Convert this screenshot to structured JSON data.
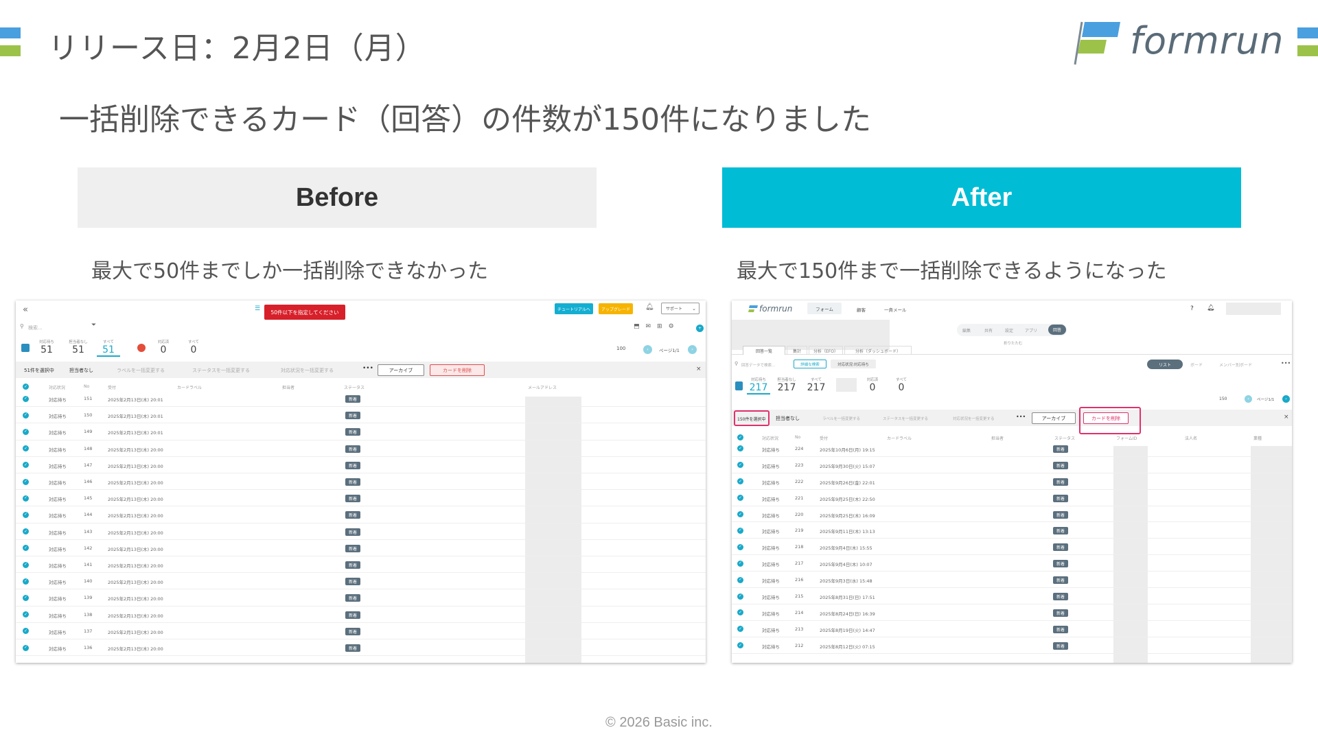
{
  "slide": {
    "title": "リリース日：2月2日（月）",
    "headline": "一括削除できるカード（回答）の件数が150件になりました",
    "logo_text": "formrun",
    "footer": "© 2026 Basic inc.",
    "colors": {
      "accent_cyan": "#00bcd4",
      "banner_gray": "#efefef",
      "deco_blue": "#4a9fdf",
      "deco_green": "#9cc24a",
      "highlight_red": "#e0306b"
    }
  },
  "before": {
    "banner_label": "Before",
    "description": "最大で50件までしか一括削除できなかった",
    "screenshot": {
      "error_toast": "50件以下を指定してください",
      "tutorial_button": "チュートリアルへ",
      "upgrade_button": "アップグレード",
      "support_select": "サポート",
      "search_placeholder": "検索...",
      "counts": [
        {
          "label": "対応待ち",
          "value": "51"
        },
        {
          "label": "担当者なし",
          "value": "51"
        },
        {
          "label": "すべて",
          "value": "51"
        },
        {
          "label": "対応済",
          "value": "0"
        },
        {
          "label": "すべて",
          "value": "0"
        }
      ],
      "per_page": "100",
      "page_indicator": "ページ1/1",
      "selected_count": "51件を選択中",
      "assignee_none": "担当者なし",
      "label_bulk": "ラベルを一括変更する",
      "status_bulk": "ステータスを一括変更する",
      "handler_bulk": "対応状況を一括変更する",
      "archive_button": "アーカイブ",
      "delete_button": "カードを削除",
      "columns": [
        "対応状況",
        "No",
        "受付",
        "カードラベル",
        "担当者",
        "ステータス",
        "メールアドレス"
      ],
      "rows": [
        {
          "status": "対応待ち",
          "no": "151",
          "date": "2025年2月13日(木) 20:01",
          "badge": "新着"
        },
        {
          "status": "対応待ち",
          "no": "150",
          "date": "2025年2月13日(木) 20:01",
          "badge": "新着"
        },
        {
          "status": "対応待ち",
          "no": "149",
          "date": "2025年2月13日(木) 20:01",
          "badge": "新着"
        },
        {
          "status": "対応待ち",
          "no": "148",
          "date": "2025年2月13日(木) 20:00",
          "badge": "新着"
        },
        {
          "status": "対応待ち",
          "no": "147",
          "date": "2025年2月13日(木) 20:00",
          "badge": "新着"
        },
        {
          "status": "対応待ち",
          "no": "146",
          "date": "2025年2月13日(木) 20:00",
          "badge": "新着"
        },
        {
          "status": "対応待ち",
          "no": "145",
          "date": "2025年2月13日(木) 20:00",
          "badge": "新着"
        },
        {
          "status": "対応待ち",
          "no": "144",
          "date": "2025年2月13日(木) 20:00",
          "badge": "新着"
        },
        {
          "status": "対応待ち",
          "no": "143",
          "date": "2025年2月13日(木) 20:00",
          "badge": "新着"
        },
        {
          "status": "対応待ち",
          "no": "142",
          "date": "2025年2月13日(木) 20:00",
          "badge": "新着"
        },
        {
          "status": "対応待ち",
          "no": "141",
          "date": "2025年2月13日(木) 20:00",
          "badge": "新着"
        },
        {
          "status": "対応待ち",
          "no": "140",
          "date": "2025年2月13日(木) 20:00",
          "badge": "新着"
        },
        {
          "status": "対応待ち",
          "no": "139",
          "date": "2025年2月13日(木) 20:00",
          "badge": "新着"
        },
        {
          "status": "対応待ち",
          "no": "138",
          "date": "2025年2月13日(木) 20:00",
          "badge": "新着"
        },
        {
          "status": "対応待ち",
          "no": "137",
          "date": "2025年2月13日(木) 20:00",
          "badge": "新着"
        },
        {
          "status": "対応待ち",
          "no": "136",
          "date": "2025年2月13日(木) 20:00",
          "badge": "新着"
        }
      ]
    }
  },
  "after": {
    "banner_label": "After",
    "description": "最大で150件まで一括削除できるようになった",
    "screenshot": {
      "logo_text": "formrun",
      "nav_tabs": [
        "フォーム",
        "顧客",
        "一斉メール"
      ],
      "sub_tabs": [
        "編集",
        "共有",
        "設定",
        "アプリ",
        "回答"
      ],
      "collapse_link": "折りたたむ",
      "view_tabs": [
        "回答一覧",
        "集計",
        "分析（EFO）",
        "分析（ダッシュボード）"
      ],
      "search_placeholder": "回答データで検索...",
      "filter_detail": "詳細な検索",
      "filter_chip": "対応状況:対応待ち",
      "view_modes": [
        "リスト",
        "ボード",
        "メンバー別ボード"
      ],
      "counts": [
        {
          "label": "対応待ち",
          "value": "217"
        },
        {
          "label": "担当者なし",
          "value": "217"
        },
        {
          "label": "すべて",
          "value": "217"
        },
        {
          "label": "対応済",
          "value": "0"
        },
        {
          "label": "すべて",
          "value": "0"
        }
      ],
      "per_page": "150",
      "page_indicator": "ページ1/1",
      "selected_count": "150件を選択中",
      "assignee_none": "担当者なし",
      "label_bulk": "ラベルを一括変更する",
      "status_bulk": "ステータスを一括変更する",
      "handler_bulk": "対応状況を一括変更する",
      "archive_button": "アーカイブ",
      "delete_button": "カードを削除",
      "columns": [
        "対応状況",
        "No",
        "受付",
        "カードラベル",
        "担当者",
        "ステータス",
        "フォームID",
        "法人名",
        "業種"
      ],
      "rows": [
        {
          "status": "対応待ち",
          "no": "224",
          "date": "2025年10月6日(月) 19:15",
          "badge": "新着"
        },
        {
          "status": "対応待ち",
          "no": "223",
          "date": "2025年9月30日(火) 15:07",
          "badge": "新着"
        },
        {
          "status": "対応待ち",
          "no": "222",
          "date": "2025年9月26日(金) 22:01",
          "badge": "新着"
        },
        {
          "status": "対応待ち",
          "no": "221",
          "date": "2025年9月25日(木) 22:50",
          "badge": "新着"
        },
        {
          "status": "対応待ち",
          "no": "220",
          "date": "2025年9月25日(木) 16:09",
          "badge": "新着"
        },
        {
          "status": "対応待ち",
          "no": "219",
          "date": "2025年9月11日(木) 13:13",
          "badge": "新着"
        },
        {
          "status": "対応待ち",
          "no": "218",
          "date": "2025年9月4日(木) 15:55",
          "badge": "新着"
        },
        {
          "status": "対応待ち",
          "no": "217",
          "date": "2025年9月4日(木) 10:07",
          "badge": "新着"
        },
        {
          "status": "対応待ち",
          "no": "216",
          "date": "2025年9月3日(水) 15:48",
          "badge": "新着"
        },
        {
          "status": "対応待ち",
          "no": "215",
          "date": "2025年8月31日(日) 17:51",
          "badge": "新着"
        },
        {
          "status": "対応待ち",
          "no": "214",
          "date": "2025年8月24日(日) 16:39",
          "badge": "新着"
        },
        {
          "status": "対応待ち",
          "no": "213",
          "date": "2025年8月19日(火) 14:47",
          "badge": "新着"
        },
        {
          "status": "対応待ち",
          "no": "212",
          "date": "2025年8月12日(火) 07:15",
          "badge": "新着"
        }
      ]
    }
  }
}
